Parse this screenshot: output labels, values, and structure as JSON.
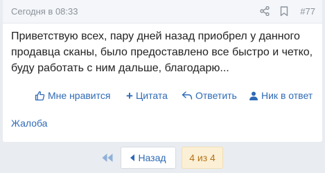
{
  "post": {
    "date": "Сегодня в 08:33",
    "number": "#77",
    "body": "Приветствую всех, пару дней назад приобрел у данного продавца сканы, было предоставлено все быстро и четко, буду работать с ним дальше, благодарю...",
    "icons": {
      "share": "share-icon",
      "bookmark": "bookmark-icon"
    }
  },
  "actions": {
    "like": "Мне нравится",
    "quote": "Цитата",
    "reply": "Ответить",
    "nick": "Ник в ответ",
    "complaint": "Жалоба"
  },
  "pager": {
    "back": "Назад",
    "current": "4 из 4"
  },
  "colors": {
    "link": "#2e6ab6",
    "muted": "#8b929b",
    "current_page_bg": "#fbf0d6",
    "current_page_text": "#b5741a"
  }
}
